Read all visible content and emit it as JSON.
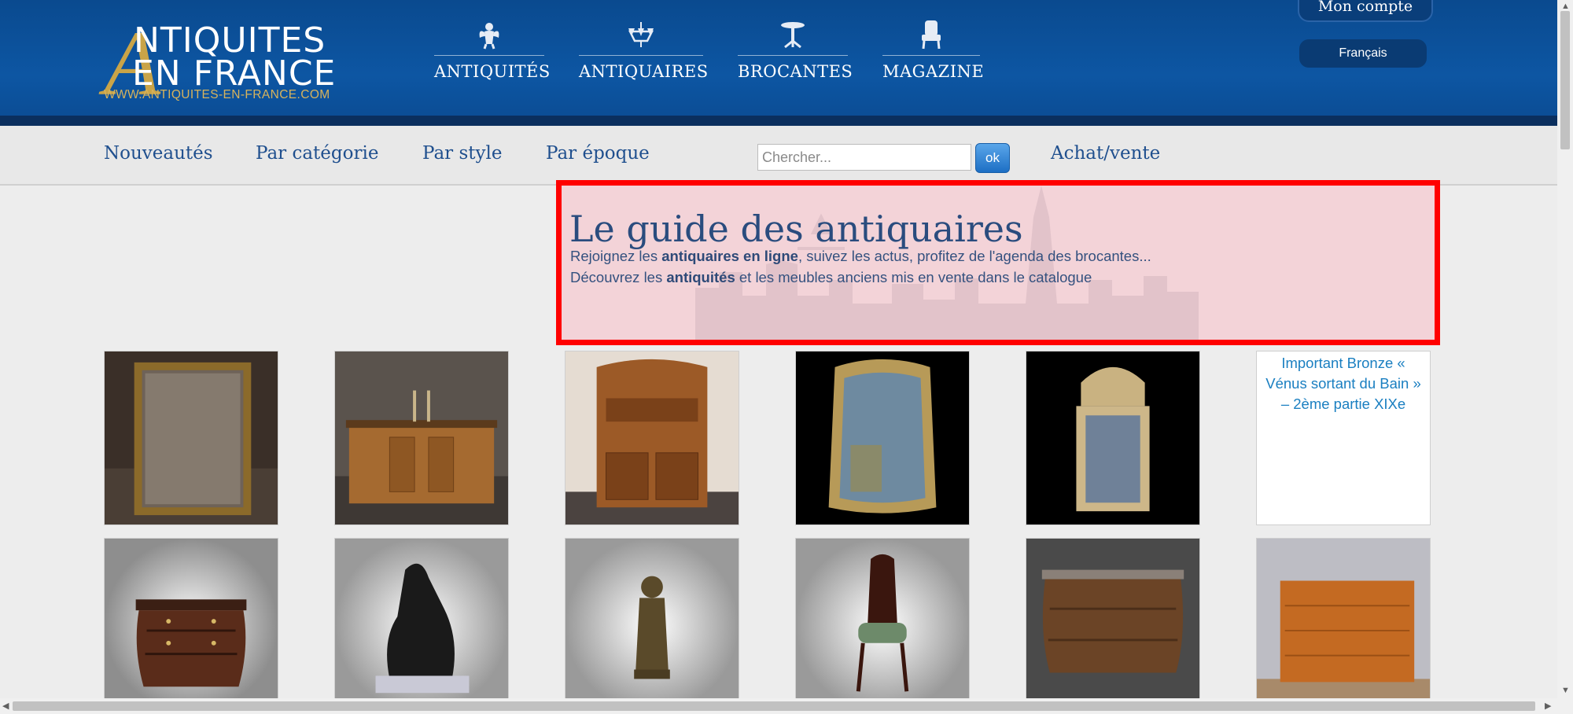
{
  "header": {
    "logo": {
      "big_letter": "A",
      "line1": "NTIQUITES",
      "line2": "EN FRANCE",
      "url": "WWW.ANTIQUITES-EN-FRANCE.COM"
    },
    "main_nav": [
      {
        "label": "ANTIQUITÉS",
        "icon": "cherub-icon"
      },
      {
        "label": "ANTIQUAIRES",
        "icon": "chandelier-icon"
      },
      {
        "label": "BROCANTES",
        "icon": "pedestal-table-icon"
      },
      {
        "label": "MAGAZINE",
        "icon": "armchair-icon"
      }
    ],
    "account_label": "Mon compte",
    "language_label": "Français"
  },
  "subnav": {
    "links": [
      "Nouveautés",
      "Par catégorie",
      "Par style",
      "Par époque"
    ],
    "search_placeholder": "Chercher...",
    "search_button": "ok",
    "buy_sell": "Achat/vente"
  },
  "guide": {
    "title": "Le guide des antiquaires",
    "line1_pre": "Rejoignez les ",
    "line1_bold": "antiquaires en ligne",
    "line1_post": ", suivez les actus, profitez de l'agenda des brocantes...",
    "line2_pre": "Découvrez les ",
    "line2_bold": "antiquités",
    "line2_post": " et les meubles anciens mis en vente dans le catalogue"
  },
  "products": {
    "broken_image_alt": "Important Bronze « Vénus sortant du Bain » – 2ème partie XIXe"
  },
  "colors": {
    "header_blue": "#0d56a3",
    "logo_gold": "#c9a448",
    "link_blue": "#1f4f8e",
    "highlight_red": "#ff0000"
  }
}
